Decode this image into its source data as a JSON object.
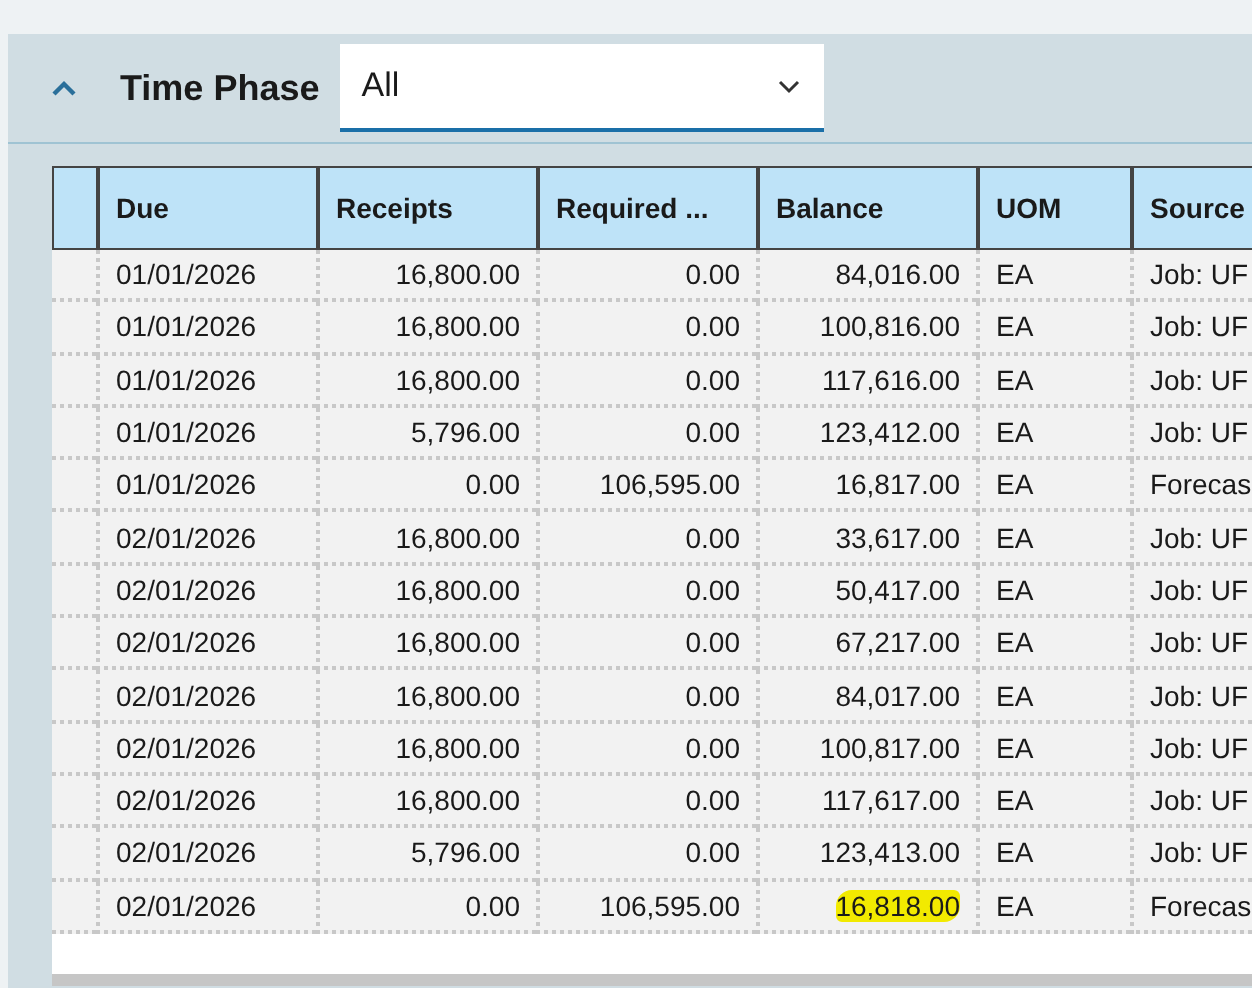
{
  "section": {
    "title": "Time Phase",
    "expanded": true
  },
  "time_phase_select": {
    "value": "All"
  },
  "table": {
    "columns": [
      "Due",
      "Receipts",
      "Required ...",
      "Balance",
      "UOM",
      "Source"
    ],
    "rows": [
      {
        "due": "01/01/2026",
        "receipts": "16,800.00",
        "required": "0.00",
        "balance": "84,016.00",
        "uom": "EA",
        "source": "Job: UF",
        "marked": false
      },
      {
        "due": "01/01/2026",
        "receipts": "16,800.00",
        "required": "0.00",
        "balance": "100,816.00",
        "uom": "EA",
        "source": "Job: UF",
        "marked": false
      },
      {
        "due": "01/01/2026",
        "receipts": "16,800.00",
        "required": "0.00",
        "balance": "117,616.00",
        "uom": "EA",
        "source": "Job: UF",
        "marked": false
      },
      {
        "due": "01/01/2026",
        "receipts": "5,796.00",
        "required": "0.00",
        "balance": "123,412.00",
        "uom": "EA",
        "source": "Job: UF",
        "marked": false
      },
      {
        "due": "01/01/2026",
        "receipts": "0.00",
        "required": "106,595.00",
        "balance": "16,817.00",
        "uom": "EA",
        "source": "Forecas",
        "marked": false
      },
      {
        "due": "02/01/2026",
        "receipts": "16,800.00",
        "required": "0.00",
        "balance": "33,617.00",
        "uom": "EA",
        "source": "Job: UF",
        "marked": false
      },
      {
        "due": "02/01/2026",
        "receipts": "16,800.00",
        "required": "0.00",
        "balance": "50,417.00",
        "uom": "EA",
        "source": "Job: UF",
        "marked": false
      },
      {
        "due": "02/01/2026",
        "receipts": "16,800.00",
        "required": "0.00",
        "balance": "67,217.00",
        "uom": "EA",
        "source": "Job: UF",
        "marked": false
      },
      {
        "due": "02/01/2026",
        "receipts": "16,800.00",
        "required": "0.00",
        "balance": "84,017.00",
        "uom": "EA",
        "source": "Job: UF",
        "marked": false
      },
      {
        "due": "02/01/2026",
        "receipts": "16,800.00",
        "required": "0.00",
        "balance": "100,817.00",
        "uom": "EA",
        "source": "Job: UF",
        "marked": false
      },
      {
        "due": "02/01/2026",
        "receipts": "16,800.00",
        "required": "0.00",
        "balance": "117,617.00",
        "uom": "EA",
        "source": "Job: UF",
        "marked": false
      },
      {
        "due": "02/01/2026",
        "receipts": "5,796.00",
        "required": "0.00",
        "balance": "123,413.00",
        "uom": "EA",
        "source": "Job: UF",
        "marked": false
      },
      {
        "due": "02/01/2026",
        "receipts": "0.00",
        "required": "106,595.00",
        "balance": "16,818.00",
        "uom": "EA",
        "source": "Forecas",
        "marked": true
      }
    ]
  }
}
